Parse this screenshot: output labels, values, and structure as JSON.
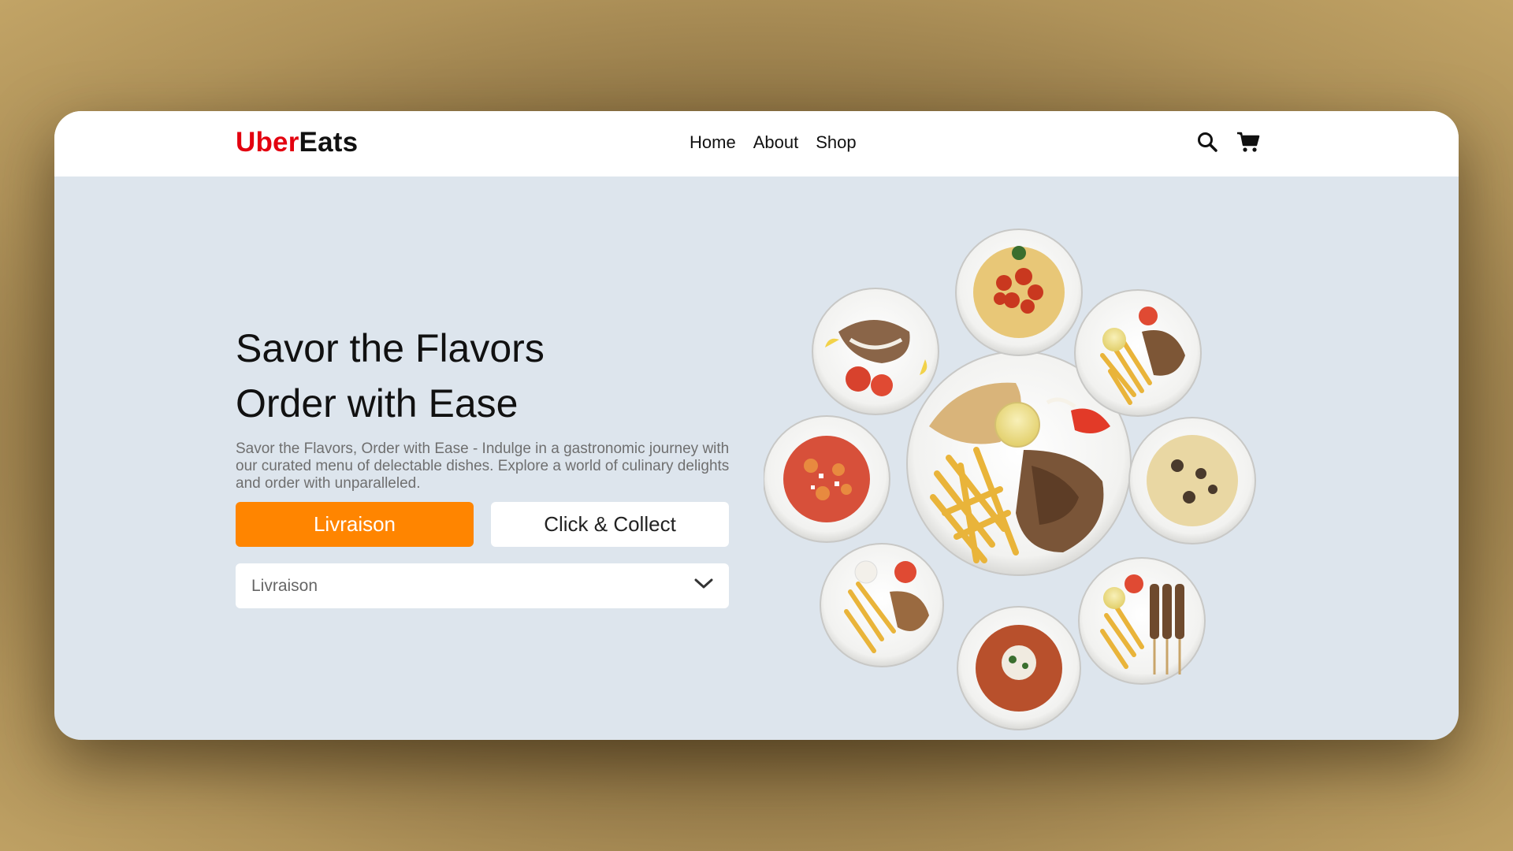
{
  "brand": {
    "part1": "Uber",
    "part2": "Eats",
    "accent": "#e3000f"
  },
  "nav": {
    "items": [
      "Home",
      "About",
      "Shop"
    ]
  },
  "icons": {
    "search": "search-icon",
    "cart": "cart-icon"
  },
  "hero": {
    "title_line1": "Savor the Flavors",
    "title_line2": "Order with Ease",
    "description": "Savor the Flavors, Order with Ease - Indulge in a gastronomic journey with our curated menu of delectable dishes. Explore a world of culinary delights and order with unparalleled.",
    "primary_button": "Livraison",
    "secondary_button": "Click & Collect",
    "select": {
      "value": "Livraison",
      "options": [
        "Livraison",
        "Click & Collect"
      ]
    }
  },
  "colors": {
    "primary_button": "#ff8500",
    "hero_bg": "#dde5ed",
    "page_bg": "#c2a466"
  }
}
